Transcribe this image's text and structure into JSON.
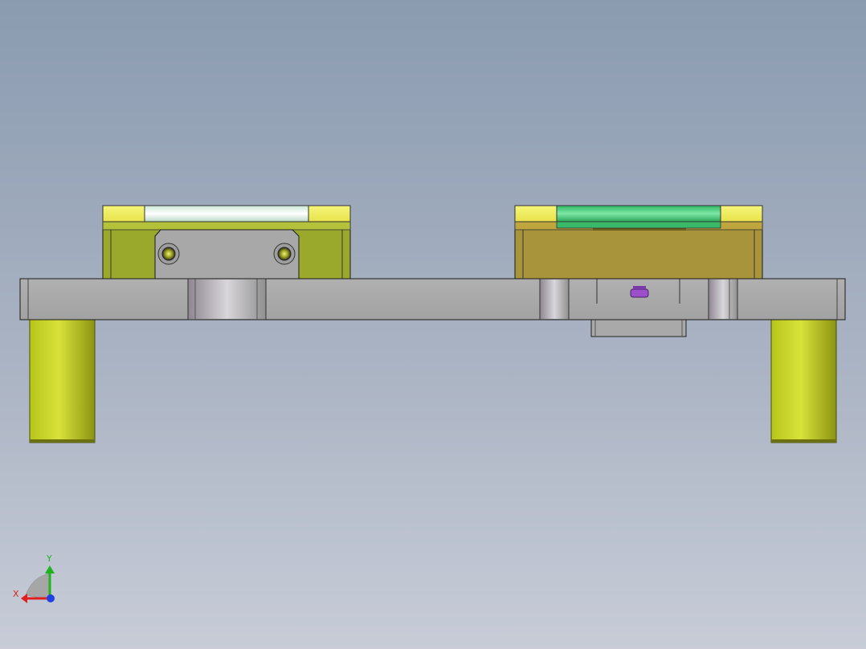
{
  "viewport": {
    "background_top": "#8a9bb0",
    "background_bottom": "#c7ccd7"
  },
  "model": {
    "parts": [
      "base-plate",
      "left-leg",
      "right-leg",
      "left-fixture-block",
      "right-fixture-block",
      "center-bracket",
      "purple-pin"
    ]
  },
  "triad": {
    "x_label": "X",
    "y_label": "Y",
    "x_color": "#e02020",
    "y_color": "#1db41d",
    "z_color": "#2040e0"
  }
}
